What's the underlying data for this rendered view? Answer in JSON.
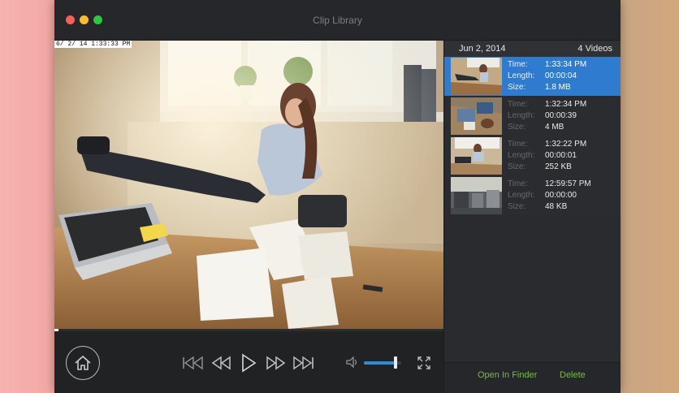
{
  "window": {
    "title": "Clip Library"
  },
  "video": {
    "overlay_timestamp": "6/ 2/ 14  1:33:33 PM",
    "progress_fraction": 0.01
  },
  "controls": {
    "home_icon": "home-icon",
    "skip_back_icon": "skip-to-start-icon",
    "rewind_icon": "rewind-icon",
    "play_icon": "play-icon",
    "forward_icon": "fast-forward-icon",
    "skip_forward_icon": "skip-to-end-icon",
    "volume_icon": "speaker-icon",
    "volume_fraction": 0.85,
    "fullscreen_icon": "fullscreen-icon"
  },
  "sidebar": {
    "date": "Jun 2, 2014",
    "count": "4 Videos",
    "labels": {
      "time": "Time:",
      "length": "Length:",
      "size": "Size:"
    },
    "clips": [
      {
        "time": "1:33:34 PM",
        "length": "00:00:04",
        "size": "1.8 MB",
        "selected": true
      },
      {
        "time": "1:32:34 PM",
        "length": "00:00:39",
        "size": "4 MB",
        "selected": false
      },
      {
        "time": "1:32:22 PM",
        "length": "00:00:01",
        "size": "252 KB",
        "selected": false
      },
      {
        "time": "12:59:57 PM",
        "length": "00:00:00",
        "size": "48 KB",
        "selected": false
      }
    ],
    "footer": {
      "open_label": "Open In Finder",
      "delete_label": "Delete"
    }
  },
  "colors": {
    "accent": "#2f7bd0",
    "footer_text": "#76bd3a",
    "window_bg": "#202224"
  }
}
